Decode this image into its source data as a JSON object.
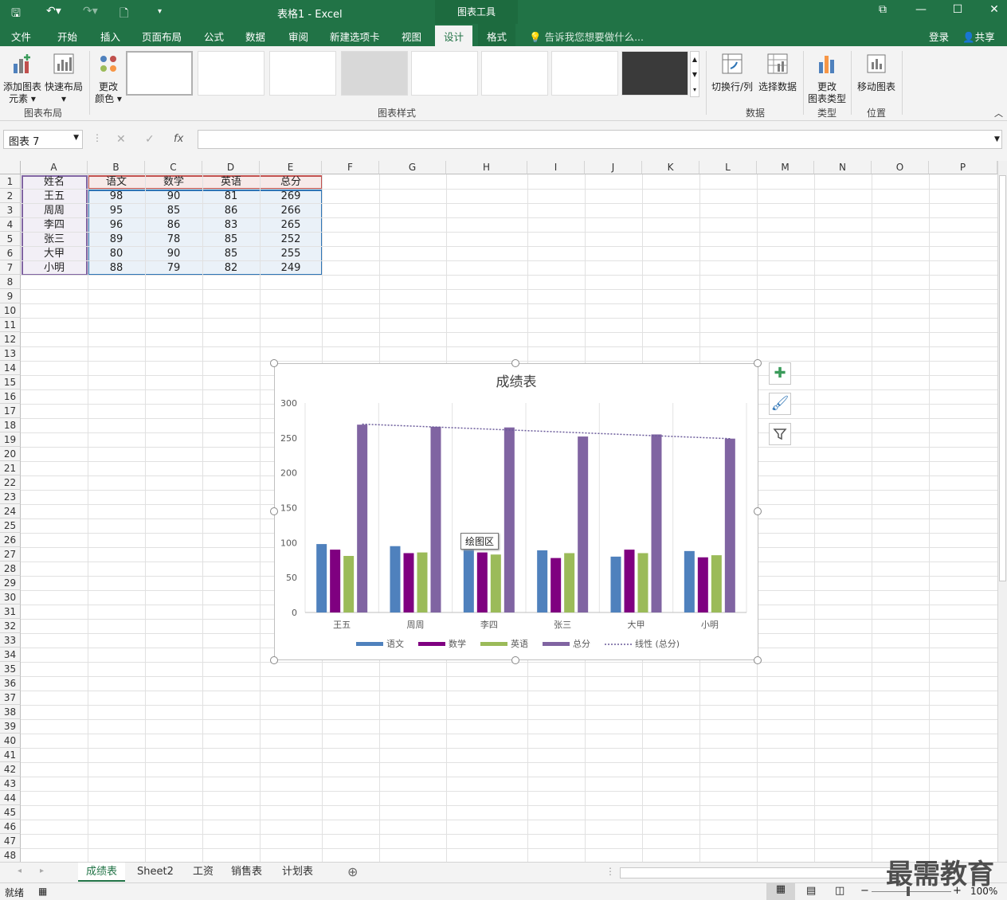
{
  "title_bar": {
    "title": "表格1 - Excel",
    "chart_tools": "图表工具"
  },
  "tabs": [
    "文件",
    "开始",
    "插入",
    "页面布局",
    "公式",
    "数据",
    "审阅",
    "新建选项卡",
    "视图",
    "设计",
    "格式"
  ],
  "tell_me": "告诉我您想要做什么...",
  "login": "登录",
  "share": "共享",
  "ribbon": {
    "add_element": [
      "添加图表",
      "元素"
    ],
    "quick_layout": "快速布局",
    "change_color": [
      "更改",
      "颜色"
    ],
    "group_layout": "图表布局",
    "group_styles": "图表样式",
    "switch_row_col": "切换行/列",
    "select_data": "选择数据",
    "group_data": "数据",
    "change_type": [
      "更改",
      "图表类型"
    ],
    "group_type": "类型",
    "move_chart": "移动图表",
    "group_location": "位置"
  },
  "name_box": "图表 7",
  "columns": [
    "A",
    "B",
    "C",
    "D",
    "E",
    "F",
    "G",
    "H",
    "I",
    "J",
    "K",
    "L",
    "M",
    "N",
    "O",
    "P"
  ],
  "table": {
    "header": [
      "姓名",
      "语文",
      "数学",
      "英语",
      "总分"
    ],
    "rows": [
      [
        "王五",
        "98",
        "90",
        "81",
        "269"
      ],
      [
        "周周",
        "95",
        "85",
        "86",
        "266"
      ],
      [
        "李四",
        "96",
        "86",
        "83",
        "265"
      ],
      [
        "张三",
        "89",
        "78",
        "85",
        "252"
      ],
      [
        "大甲",
        "80",
        "90",
        "85",
        "255"
      ],
      [
        "小明",
        "88",
        "79",
        "82",
        "249"
      ]
    ]
  },
  "tooltip": "绘图区",
  "chart_data": {
    "type": "bar",
    "title": "成绩表",
    "categories": [
      "王五",
      "周周",
      "李四",
      "张三",
      "大甲",
      "小明"
    ],
    "series": [
      {
        "name": "语文",
        "values": [
          98,
          95,
          96,
          89,
          80,
          88
        ],
        "color": "#4f81bd"
      },
      {
        "name": "数学",
        "values": [
          90,
          85,
          86,
          78,
          90,
          79
        ],
        "color": "#7f0080"
      },
      {
        "name": "英语",
        "values": [
          81,
          86,
          83,
          85,
          85,
          82
        ],
        "color": "#9bbb59"
      },
      {
        "name": "总分",
        "values": [
          269,
          266,
          265,
          252,
          255,
          249
        ],
        "color": "#8064a2"
      }
    ],
    "trendline": {
      "name": "线性 (总分)",
      "of": "总分"
    },
    "ylim": [
      0,
      300
    ],
    "yticks": [
      0,
      50,
      100,
      150,
      200,
      250,
      300
    ],
    "legend_position": "bottom",
    "grid": true
  },
  "sheets": [
    "成绩表",
    "Sheet2",
    "工资",
    "销售表",
    "计划表"
  ],
  "status": {
    "ready": "就绪",
    "zoom": "100%"
  },
  "watermark": "最需教育"
}
